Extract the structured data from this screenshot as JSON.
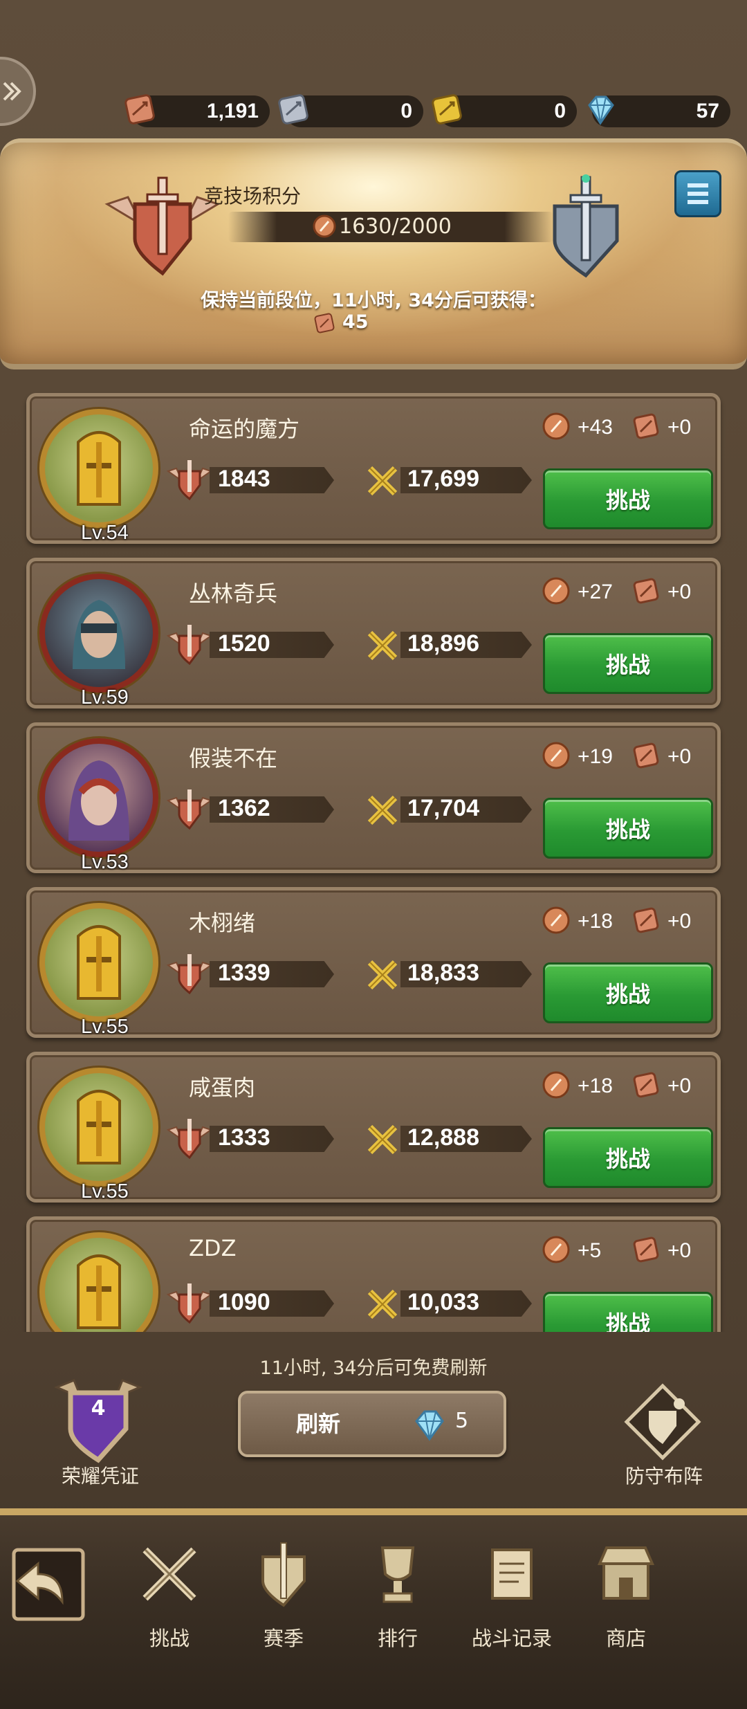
{
  "currencies": [
    {
      "icon": "copper-ticket-icon",
      "value": "1,191"
    },
    {
      "icon": "silver-ticket-icon",
      "value": "0"
    },
    {
      "icon": "gold-ticket-icon",
      "value": "0"
    },
    {
      "icon": "diamond-icon",
      "value": "57"
    }
  ],
  "banner": {
    "title": "竞技场积分",
    "score": "1630/2000",
    "reward_text": "保持当前段位，11小时, 34分后可获得：",
    "reward_value": "45"
  },
  "opponents": [
    {
      "name": "命运的魔方",
      "level": "Lv.54",
      "rating": "1843",
      "power": "17,699",
      "points_gain": "+43",
      "ticket_gain": "+0",
      "avatar": "golden-knight"
    },
    {
      "name": "丛林奇兵",
      "level": "Lv.59",
      "rating": "1520",
      "power": "18,896",
      "points_gain": "+27",
      "ticket_gain": "+0",
      "avatar": "masked-archer"
    },
    {
      "name": "假装不在",
      "level": "Lv.53",
      "rating": "1362",
      "power": "17,704",
      "points_gain": "+19",
      "ticket_gain": "+0",
      "avatar": "hooded-rogue"
    },
    {
      "name": "木栩绪",
      "level": "Lv.55",
      "rating": "1339",
      "power": "18,833",
      "points_gain": "+18",
      "ticket_gain": "+0",
      "avatar": "golden-knight"
    },
    {
      "name": "咸蛋肉",
      "level": "Lv.55",
      "rating": "1333",
      "power": "12,888",
      "points_gain": "+18",
      "ticket_gain": "+0",
      "avatar": "golden-knight"
    },
    {
      "name": "ZDZ",
      "level": "",
      "rating": "1090",
      "power": "10,033",
      "points_gain": "+5",
      "ticket_gain": "+0",
      "avatar": "golden-knight"
    }
  ],
  "challenge_label": "挑战",
  "refresh": {
    "note": "11小时, 34分后可免费刷新",
    "label": "刷新",
    "cost": "5"
  },
  "glory_badge": {
    "count": "4",
    "label": "荣耀凭证"
  },
  "defense": {
    "label": "防守布阵"
  },
  "nav": [
    {
      "label": "挑战",
      "icon": "crossed-swords-icon"
    },
    {
      "label": "赛季",
      "icon": "shield-sword-icon"
    },
    {
      "label": "排行",
      "icon": "trophy-icon"
    },
    {
      "label": "战斗记录",
      "icon": "scroll-icon"
    },
    {
      "label": "商店",
      "icon": "shop-icon"
    }
  ],
  "colors": {
    "challenge_green": "#2a9a34",
    "panel_brown": "#6a5643",
    "gold_trim": "#c9a764"
  }
}
